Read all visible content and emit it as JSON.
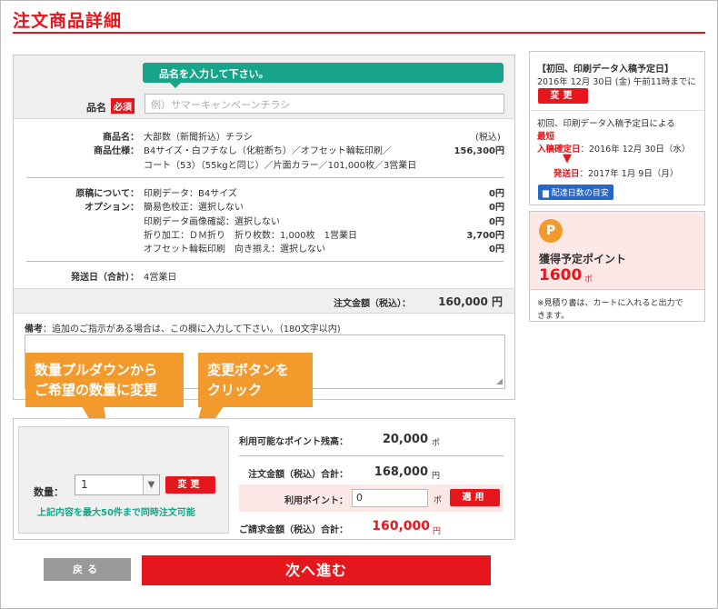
{
  "page": {
    "title": "注文商品詳細"
  },
  "product_form": {
    "tooltip": "品名を入力して下さい。",
    "name_label": "品名",
    "required_badge": "必須",
    "name_placeholder": "例）サマーキャンペーンチラシ"
  },
  "product_info": {
    "name_label": "商品名：",
    "name_value": "大部数（新聞折込）チラシ",
    "tax_note": "(税込)",
    "spec_label": "商品仕様：",
    "spec_line1": "B4サイズ・白フチなし（化粧断ち）／オフセット輪転印刷／",
    "spec_line2": "コート（53）（55kgと同じ）／片面カラー／101,000枚／3営業日",
    "spec_price": "156,300円"
  },
  "options": {
    "manuscript_label": "原稿について：",
    "option_label": "オプション：",
    "rows": [
      {
        "text": "印刷データ：B4サイズ",
        "price": "0円"
      },
      {
        "text": "簡易色校正：選択しない",
        "price": "0円"
      },
      {
        "text": "印刷データ画像確認：選択しない",
        "price": "0円"
      },
      {
        "text": "折り加工：ＤＭ折り　折り枚数：1,000枚　1営業日",
        "price": "3,700円"
      },
      {
        "text": "オフセット輪転印刷　向き揃え：選択しない",
        "price": "0円"
      }
    ]
  },
  "shipping": {
    "label": "発送日（合計）：",
    "value": "4営業日"
  },
  "order_total": {
    "label": "注文金額（税込）：",
    "value": "160,000 円"
  },
  "remarks": {
    "label": "備考",
    "text": "：追加のご指示がある場合は、この欄に入力して下さい。（180文字以内)"
  },
  "callouts": {
    "left_line1": "数量プルダウンから",
    "left_line2": "ご希望の数量に変更",
    "right_line1": "変更ボタンを",
    "right_line2": "クリック"
  },
  "quantity": {
    "label": "数量：",
    "selected": "1",
    "change_button": "変更",
    "note": "上記内容を最大50件まで同時注文可能"
  },
  "summary": {
    "points_balance_label": "利用可能なポイント残高：",
    "points_balance_value": "20,000",
    "points_unit": "ポ",
    "order_amount_label": "注文金額（税込）合計：",
    "order_amount_value": "168,000",
    "yen_unit": "円",
    "use_points_label": "利用ポイント：",
    "use_points_value": "0",
    "apply_button": "適用",
    "billing_label": "ご請求金額（税込）合計：",
    "billing_value": "160,000"
  },
  "sidebar_schedule": {
    "heading": "【初回、印刷データ入稿予定日】",
    "date_line": "2016年 12月 30日 (金) 午前11時までに",
    "change_button": "変更",
    "intro": "初回、印刷データ入稿予定日による",
    "fastest": "最短",
    "confirm_label": "入稿確定日",
    "confirm_value": "：2016年 12月 30日（水）",
    "ship_label": "発送日",
    "ship_value": "：2017年 1月 9日（月）",
    "guide_button": "配達日数の目安"
  },
  "sidebar_points": {
    "icon_letter": "P",
    "label": "獲得予定ポイント",
    "value": "1600",
    "unit": "ポ",
    "note_line1": "※見積り書は、カートに入れると出力で",
    "note_line2": "きます。"
  },
  "nav": {
    "back_button": "戻る",
    "next_button": "次へ進む"
  },
  "colors": {
    "accent_red": "#e5161c",
    "teal": "#16a589",
    "orange": "#f39a2d",
    "blue": "#2a67c5"
  }
}
